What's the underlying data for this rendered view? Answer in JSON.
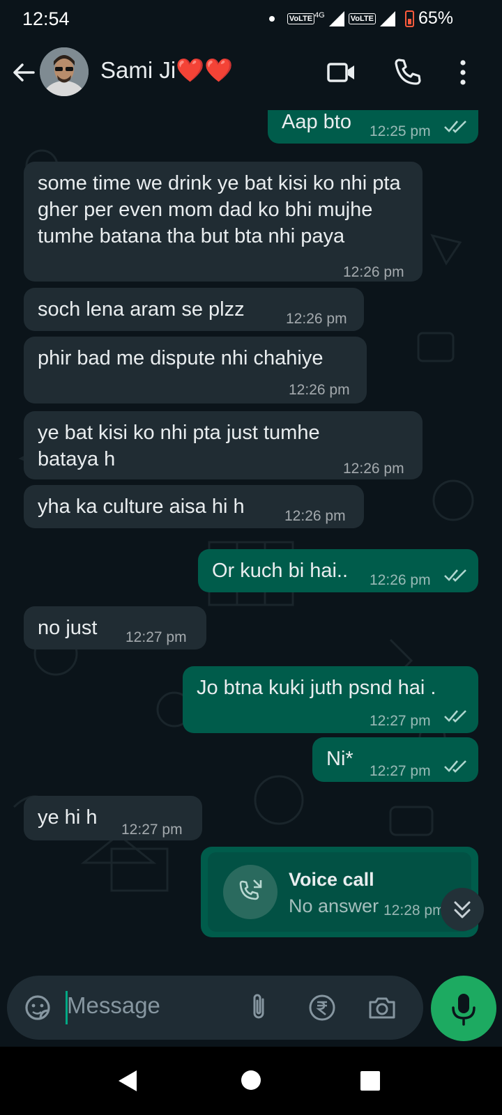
{
  "status_bar": {
    "time": "12:54",
    "network_labels": [
      "VoLTE",
      "4G",
      "VoLTE"
    ],
    "battery": "65%"
  },
  "header": {
    "contact_name": "Sami Ji❤️❤️",
    "icons": [
      "back-arrow-icon",
      "video-call-icon",
      "phone-icon",
      "more-vert-icon"
    ]
  },
  "messages": [
    {
      "dir": "out",
      "text": "Aap bto",
      "time": "12:25 pm",
      "read": true
    },
    {
      "dir": "in",
      "text": "some time we drink ye bat kisi ko nhi pta gher per even mom dad ko bhi mujhe tumhe batana tha but bta nhi paya",
      "time": "12:26 pm"
    },
    {
      "dir": "in",
      "text": "soch lena aram se plzz",
      "time": "12:26 pm"
    },
    {
      "dir": "in",
      "text": "phir bad me dispute nhi chahiye",
      "time": "12:26 pm"
    },
    {
      "dir": "in",
      "text": "ye bat kisi ko nhi pta just tumhe bataya h",
      "time": "12:26 pm"
    },
    {
      "dir": "in",
      "text": "yha ka culture aisa hi h",
      "time": "12:26 pm"
    },
    {
      "dir": "out",
      "text": "Or kuch bi hai..",
      "time": "12:26 pm",
      "read": true
    },
    {
      "dir": "in",
      "text": "no just",
      "time": "12:27 pm"
    },
    {
      "dir": "out",
      "text": "Jo btna kuki juth psnd hai .",
      "time": "12:27 pm",
      "read": true
    },
    {
      "dir": "out",
      "text": "Ni*",
      "time": "12:27 pm",
      "read": true
    },
    {
      "dir": "in",
      "text": "ye hi h",
      "time": "12:27 pm"
    }
  ],
  "call": {
    "title": "Voice call",
    "subtitle": "No answer",
    "time": "12:28 pm"
  },
  "input": {
    "placeholder": "Message"
  },
  "colors": {
    "incoming": "#202c33",
    "outgoing": "#005c4b",
    "accent": "#1daa61",
    "read_tick": "#b0d6cf"
  }
}
